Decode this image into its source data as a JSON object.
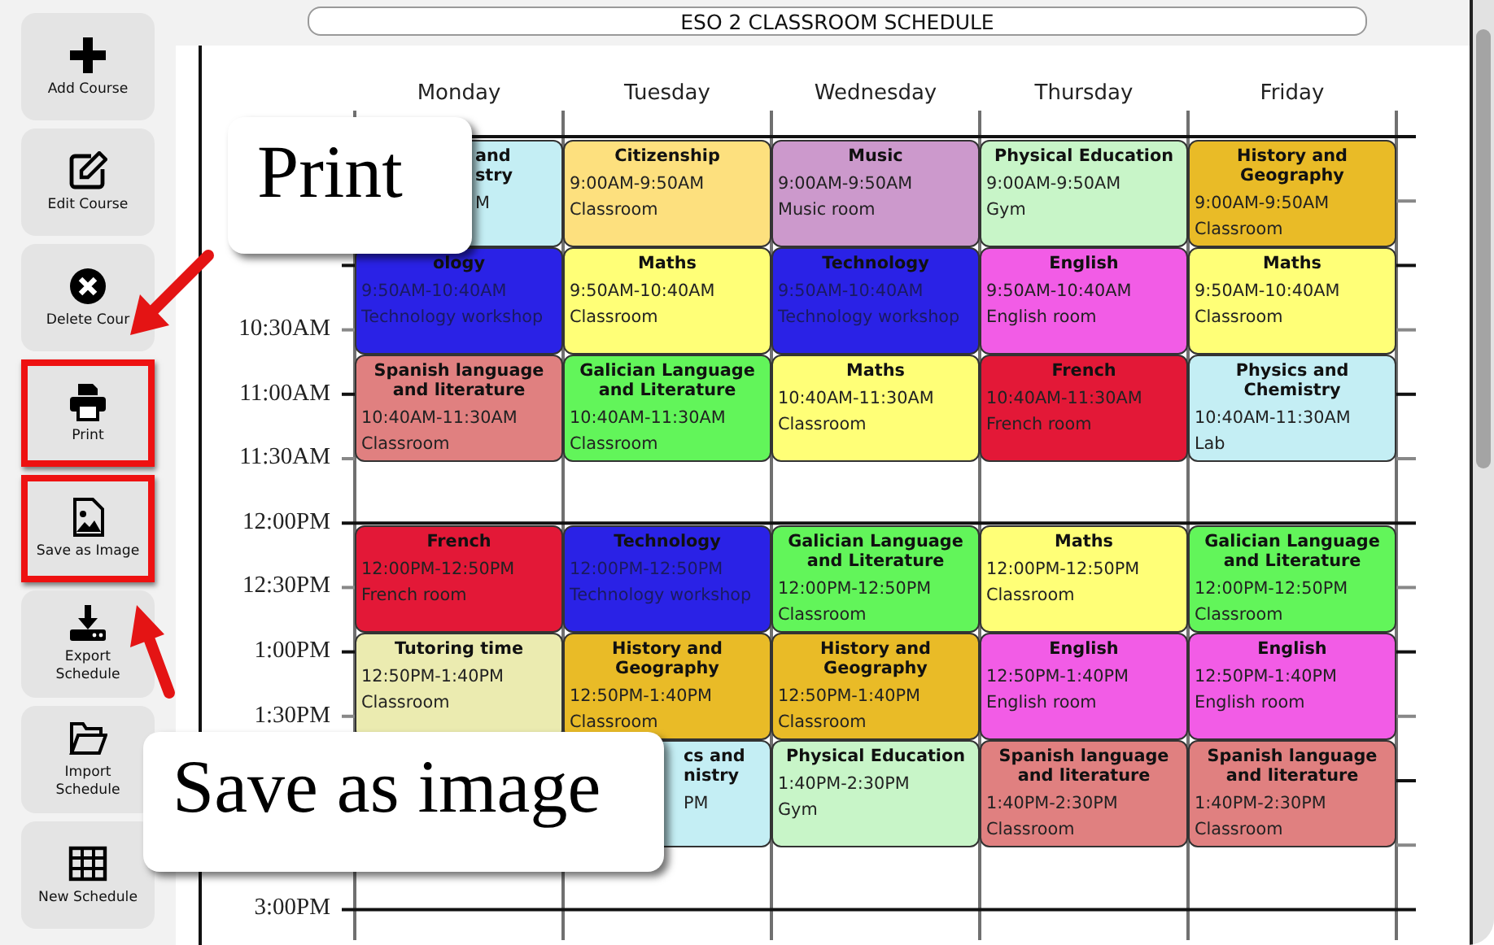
{
  "title": "ESO 2 CLASSROOM SCHEDULE",
  "sidebar": [
    {
      "label": "Add Course",
      "highlighted": false
    },
    {
      "label": "Edit Course",
      "highlighted": false
    },
    {
      "label": "Delete Cour",
      "highlighted": false
    },
    {
      "label": "Print",
      "highlighted": true
    },
    {
      "label": "Save as Image",
      "highlighted": true
    },
    {
      "label": "Export Schedule",
      "highlighted": false
    },
    {
      "label": "Import Schedule",
      "highlighted": false
    },
    {
      "label": "New Schedule",
      "highlighted": false
    }
  ],
  "days": [
    {
      "name": "Monday",
      "courses": [
        {
          "kind": "partial",
          "title": "and\nstry",
          "time": "M",
          "color": "#c4eef4"
        },
        {
          "kind": "course",
          "title": "ology",
          "time": "9:50AM-10:40AM",
          "room": "Technology workshop",
          "color": "#2a22e6"
        },
        {
          "kind": "course",
          "title": "Spanish language and literature",
          "time": "10:40AM-11:30AM",
          "room": "Classroom",
          "color": "#e08080"
        },
        {
          "kind": "course",
          "title": "French",
          "time": "12:00PM-12:50PM",
          "room": "French room",
          "color": "#e31837"
        },
        {
          "kind": "course",
          "title": "Tutoring time",
          "time": "12:50PM-1:40PM",
          "room": "Classroom",
          "color": "#ebebb0"
        }
      ]
    },
    {
      "name": "Tuesday",
      "courses": [
        {
          "kind": "course",
          "title": "Citizenship",
          "time": "9:00AM-9:50AM",
          "room": "Classroom",
          "color": "#fde07e"
        },
        {
          "kind": "course",
          "title": "Maths",
          "time": "9:50AM-10:40AM",
          "room": "Classroom",
          "color": "#ffff77"
        },
        {
          "kind": "course",
          "title": "Galician Language and Literature",
          "time": "10:40AM-11:30AM",
          "room": "Classroom",
          "color": "#62f55a"
        },
        {
          "kind": "course",
          "title": "Technology",
          "time": "12:00PM-12:50PM",
          "room": "Technology workshop",
          "color": "#2a22e6"
        },
        {
          "kind": "course",
          "title": "History and Geography",
          "time": "12:50PM-1:40PM",
          "room": "Classroom",
          "color": "#e9bb27"
        },
        {
          "kind": "partial",
          "title": "cs and\nnistry",
          "time": "PM",
          "color": "#c4eef4"
        }
      ]
    },
    {
      "name": "Wednesday",
      "courses": [
        {
          "kind": "course",
          "title": "Music",
          "time": "9:00AM-9:50AM",
          "room": "Music room",
          "color": "#cc99cc"
        },
        {
          "kind": "course",
          "title": "Technology",
          "time": "9:50AM-10:40AM",
          "room": "Technology workshop",
          "color": "#2a22e6"
        },
        {
          "kind": "course",
          "title": "Maths",
          "time": "10:40AM-11:30AM",
          "room": "Classroom",
          "color": "#ffff77"
        },
        {
          "kind": "course",
          "title": "Galician Language and Literature",
          "time": "12:00PM-12:50PM",
          "room": "Classroom",
          "color": "#62f55a"
        },
        {
          "kind": "course",
          "title": "History and Geography",
          "time": "12:50PM-1:40PM",
          "room": "Classroom",
          "color": "#e9bb27"
        },
        {
          "kind": "course",
          "title": "Physical Education",
          "time": "1:40PM-2:30PM",
          "room": "Gym",
          "color": "#c8f5c8"
        }
      ]
    },
    {
      "name": "Thursday",
      "courses": [
        {
          "kind": "course",
          "title": "Physical Education",
          "time": "9:00AM-9:50AM",
          "room": "Gym",
          "color": "#c8f5c8"
        },
        {
          "kind": "course",
          "title": "English",
          "time": "9:50AM-10:40AM",
          "room": "English room",
          "color": "#f25ce6"
        },
        {
          "kind": "course",
          "title": "French",
          "time": "10:40AM-11:30AM",
          "room": "French room",
          "color": "#e31837"
        },
        {
          "kind": "course",
          "title": "Maths",
          "time": "12:00PM-12:50PM",
          "room": "Classroom",
          "color": "#ffff77"
        },
        {
          "kind": "course",
          "title": "English",
          "time": "12:50PM-1:40PM",
          "room": "English room",
          "color": "#f25ce6"
        },
        {
          "kind": "course",
          "title": "Spanish language and literature",
          "time": "1:40PM-2:30PM",
          "room": "Classroom",
          "color": "#e08080"
        }
      ]
    },
    {
      "name": "Friday",
      "courses": [
        {
          "kind": "course",
          "title": "History and Geography",
          "time": "9:00AM-9:50AM",
          "room": "Classroom",
          "color": "#e9bb27"
        },
        {
          "kind": "course",
          "title": "Maths",
          "time": "9:50AM-10:40AM",
          "room": "Classroom",
          "color": "#ffff77"
        },
        {
          "kind": "course",
          "title": "Physics and Chemistry",
          "time": "10:40AM-11:30AM",
          "room": "Lab",
          "color": "#c4eef4"
        },
        {
          "kind": "course",
          "title": "Galician Language and Literature",
          "time": "12:00PM-12:50PM",
          "room": "Classroom",
          "color": "#62f55a"
        },
        {
          "kind": "course",
          "title": "English",
          "time": "12:50PM-1:40PM",
          "room": "English room",
          "color": "#f25ce6"
        },
        {
          "kind": "course",
          "title": "Spanish language and literature",
          "time": "1:40PM-2:30PM",
          "room": "Classroom",
          "color": "#e08080"
        }
      ]
    }
  ],
  "time_labels": [
    "10:30AM",
    "11:00AM",
    "11:30AM",
    "12:00PM",
    "12:30PM",
    "1:00PM",
    "1:30PM",
    "3:00PM"
  ],
  "callouts": [
    "Print",
    "Save as image"
  ]
}
